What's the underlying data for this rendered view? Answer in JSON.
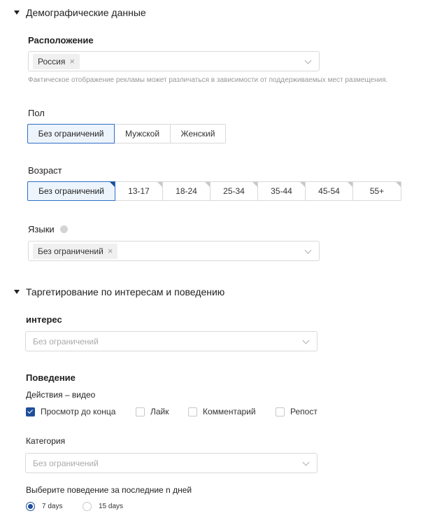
{
  "demographics": {
    "title": "Демографические данные",
    "location": {
      "label": "Расположение",
      "tag": "Россия",
      "hint": "Фактическое отображение рекламы может различаться в зависимости от поддерживаемых мест размещения."
    },
    "gender": {
      "label": "Пол",
      "options": [
        "Без ограничений",
        "Мужской",
        "Женский"
      ],
      "selected": "Без ограничений"
    },
    "age": {
      "label": "Возраст",
      "options": [
        "Без ограничений",
        "13-17",
        "18-24",
        "25-34",
        "35-44",
        "45-54",
        "55+"
      ],
      "selected": "Без ограничений"
    },
    "languages": {
      "label": "Языки",
      "tag": "Без ограничений"
    }
  },
  "targeting": {
    "title": "Таргетирование по интересам и поведению",
    "interest": {
      "label": "интерес",
      "placeholder": "Без ограничений"
    },
    "behavior": {
      "label": "Поведение",
      "actions_label": "Действия – видео",
      "checkboxes": [
        {
          "label": "Просмотр до конца",
          "checked": true
        },
        {
          "label": "Лайк",
          "checked": false
        },
        {
          "label": "Комментарий",
          "checked": false
        },
        {
          "label": "Репост",
          "checked": false
        }
      ],
      "category_label": "Категория",
      "category_placeholder": "Без ограничений",
      "period_label": "Выберите поведение за последние n дней",
      "period_options": [
        {
          "label": "7 days",
          "checked": true
        },
        {
          "label": "15 days",
          "checked": false
        }
      ]
    }
  },
  "colors": {
    "accent": "#1f4f9a",
    "active_bg": "#eef4fc",
    "border": "#d9d9d9"
  }
}
